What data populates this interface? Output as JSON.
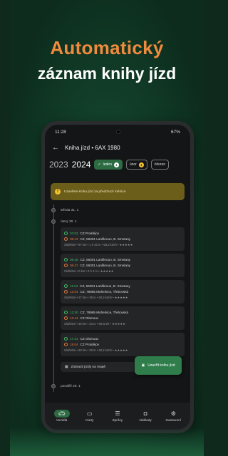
{
  "headline": {
    "line1": "Automatický",
    "line2": "záznam knihy jízd"
  },
  "status_bar": {
    "time": "11:28",
    "right": "67%"
  },
  "app_bar": {
    "title": "Kniha jízd • 6AX 1980"
  },
  "filters": {
    "years": [
      "2023",
      "2024"
    ],
    "chips": [
      {
        "label": "leden",
        "count": "1",
        "selected": true
      },
      {
        "label": "únor",
        "count": "1",
        "selected": false
      },
      {
        "label": "březen",
        "count": "",
        "selected": false
      }
    ]
  },
  "banner": {
    "text": "Uzavřete knihu jízd za předchozí měsíce"
  },
  "days": [
    {
      "label": "středa 31. 1"
    },
    {
      "label": "úterý 30. 1"
    },
    {
      "label": "pondělí 29. 1"
    }
  ],
  "trips": [
    {
      "start_time": "07:02",
      "start_place": "CZ Prostějov",
      "end_time": "08:43",
      "end_place": "CZ, 56301 Lanškroun, B. Smetany",
      "meta": "Služební • 97 km • 1 h 40 m • 58,2 km/h • ★★★★★"
    },
    {
      "start_time": "08:46",
      "start_place": "CZ, 56301 Lanškroun, B. Smetany",
      "end_time": "08:47",
      "end_place": "CZ, 56301 Lanškroun, B. Smetany",
      "meta": "Služební • 0 km • 0 h 4 m • ★★★★★"
    },
    {
      "start_time": "11:24",
      "start_place": "CZ, 56301 Lanškroun, B. Smetany",
      "end_time": "12:04",
      "end_place": "CZ, 78985 Mohelnice, Třebovská",
      "meta": "Služební • 27 km • 39 m • 40,3 km/h • ★★★★★"
    },
    {
      "start_time": "12:30",
      "start_place": "CZ, 78985 Mohelnice, Třebovská",
      "end_time": "12:44",
      "end_place": "CZ Olomouc",
      "meta": "Služební • 30 km • 23 m • 66 km/h • ★★★★★"
    },
    {
      "start_time": "17:31",
      "start_place": "CZ Olomouc",
      "end_time": "18:04",
      "end_place": "CZ Prostějov",
      "meta": "Služební • 23 km • 33 m • 40,2 km/h • ★★★★★"
    }
  ],
  "actions": {
    "show_map": "Zobrazit jízdy na mapě",
    "close_book": "Uzavřít knihu jízd"
  },
  "nav": [
    {
      "label": "Vozidla",
      "icon": "car-icon",
      "active": true
    },
    {
      "label": "Karty",
      "icon": "card-icon",
      "active": false
    },
    {
      "label": "Zprávy",
      "icon": "message-icon",
      "active": false
    },
    {
      "label": "Náklady",
      "icon": "wallet-icon",
      "active": false
    },
    {
      "label": "Nastavení",
      "icon": "gear-icon",
      "active": false
    }
  ],
  "colors": {
    "accent_orange": "#f08a3c",
    "brand_green": "#2e7d4a"
  }
}
